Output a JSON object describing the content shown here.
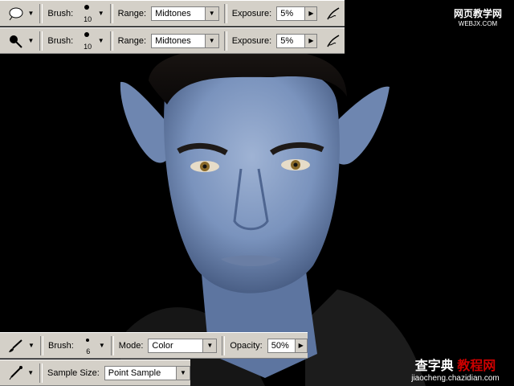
{
  "toolbar_dodge": {
    "tool_icon": "dodge-icon",
    "brush_label": "Brush:",
    "brush_size": "10",
    "range_label": "Range:",
    "range_value": "Midtones",
    "exposure_label": "Exposure:",
    "exposure_value": "5%"
  },
  "toolbar_burn": {
    "tool_icon": "burn-icon",
    "brush_label": "Brush:",
    "brush_size": "10",
    "range_label": "Range:",
    "range_value": "Midtones",
    "exposure_label": "Exposure:",
    "exposure_value": "5%"
  },
  "toolbar_brush": {
    "tool_icon": "brush-icon",
    "brush_label": "Brush:",
    "brush_size": "6",
    "mode_label": "Mode:",
    "mode_value": "Color",
    "opacity_label": "Opacity:",
    "opacity_value": "50%"
  },
  "toolbar_eyedropper": {
    "tool_icon": "eyedropper-icon",
    "sample_label": "Sample Size:",
    "sample_value": "Point Sample"
  },
  "watermark_top": {
    "line1": "网页教学网",
    "line2": "WEBJX.COM"
  },
  "watermark_bottom": {
    "line1_a": "查字典",
    "line1_b": "教程网",
    "line2": "jiaocheng.chazidian.com"
  },
  "colors": {
    "toolbar_bg": "#d4d0c8",
    "skin": "#7a93bd",
    "background": "#000000"
  }
}
